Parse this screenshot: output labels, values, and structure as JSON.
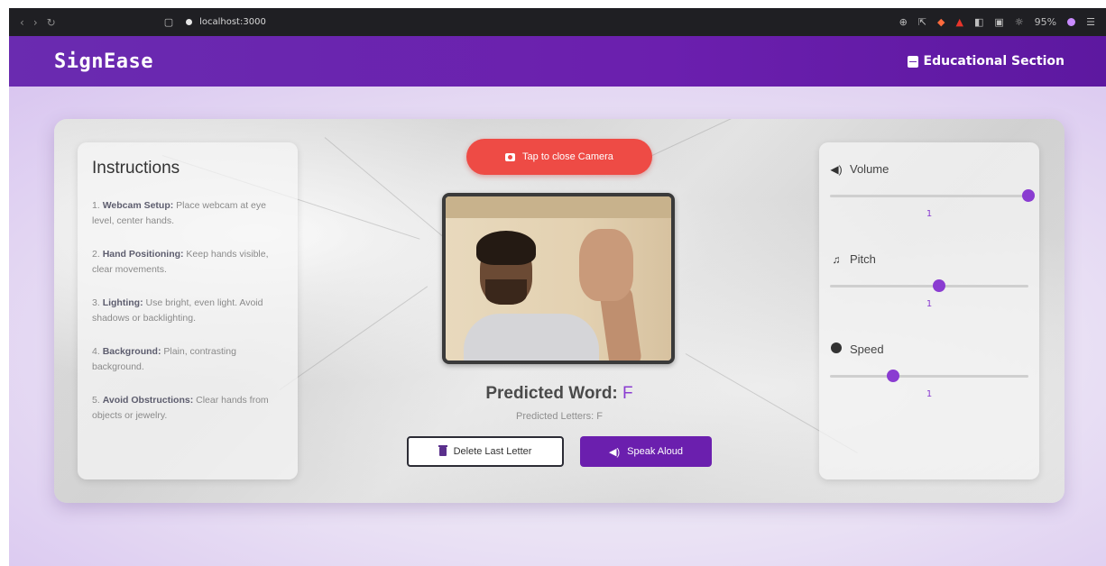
{
  "browser": {
    "url": "localhost:3000",
    "zoom": "95%"
  },
  "header": {
    "brand": "SignEase",
    "edu_link": "Educational Section"
  },
  "instructions": {
    "title": "Instructions",
    "items": [
      {
        "num": "1.",
        "bold": "Webcam Setup:",
        "text": " Place webcam at eye level, center hands."
      },
      {
        "num": "2.",
        "bold": "Hand Positioning:",
        "text": " Keep hands visible, clear movements."
      },
      {
        "num": "3.",
        "bold": "Lighting:",
        "text": " Use bright, even light. Avoid shadows or backlighting."
      },
      {
        "num": "4.",
        "bold": "Background:",
        "text": " Plain, contrasting background."
      },
      {
        "num": "5.",
        "bold": "Avoid Obstructions:",
        "text": " Clear hands from objects or jewelry."
      }
    ]
  },
  "camera": {
    "toggle_label": "Tap to close Camera"
  },
  "prediction": {
    "word_label": "Predicted Word:",
    "word_value": "F",
    "letters_text": "Predicted Letters: F"
  },
  "actions": {
    "delete_label": "Delete Last Letter",
    "speak_label": "Speak Aloud"
  },
  "controls": {
    "volume": {
      "label": "Volume",
      "value": "1",
      "level": 1.0,
      "icon": "speaker-icon"
    },
    "pitch": {
      "label": "Pitch",
      "value": "1",
      "level": 0.55,
      "icon": "music-note-icon"
    },
    "speed": {
      "label": "Speed",
      "value": "1",
      "level": 0.32,
      "icon": "gauge-icon"
    }
  },
  "colors": {
    "accent": "#6b1fae",
    "camera_button": "#ee4b45",
    "slider_thumb": "#8a3cd1"
  }
}
